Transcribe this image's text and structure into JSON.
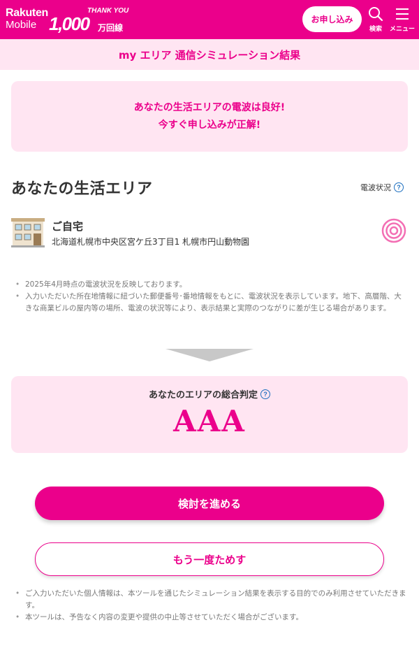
{
  "header": {
    "logo_line1": "Rakuten",
    "logo_line2": "Mobile",
    "campaign_thanks": "THANK YOU",
    "campaign_number": "1,000",
    "campaign_unit": "万回線",
    "apply_label": "お申し込み",
    "search_label": "検索",
    "menu_label": "メニュー"
  },
  "page": {
    "title": "my エリア 通信シミュレーション結果"
  },
  "result_message": {
    "line1": "あなたの生活エリアの電波は良好!",
    "line2": "今すぐ申し込みが正解!"
  },
  "area": {
    "title": "あなたの生活エリア",
    "signal_status_label": "電波状況",
    "place_name": "ご自宅",
    "place_address": "北海道札幌市中央区宮ケ丘3丁目1 札幌市円山動物園",
    "notes": [
      "2025年4月時点の電波状況を反映しております。",
      "入力いただいた所在地情報に紐づいた郵便番号･番地情報をもとに、電波状況を表示しています。地下、高層階、大きな商業ビルの屋内等の場所、電波の状況等により、表示結果と実際のつながりに差が生じる場合があります。"
    ]
  },
  "judgement": {
    "label": "あなたのエリアの総合判定",
    "value": "AAA"
  },
  "actions": {
    "proceed_label": "検討を進める",
    "retry_label": "もう一度ためす"
  },
  "footer_notes": [
    "ご入力いただいた個人情報は、本ツールを通じたシミュレーション結果を表示する目的でのみ利用させていただきます。",
    "本ツールは、予告なく内容の変更や提供の中止等させていただく場合がございます。"
  ],
  "colors": {
    "brand": "#eb008b",
    "brand_light_bg": "#ffe5f2",
    "help_icon": "#1d6fbf"
  }
}
